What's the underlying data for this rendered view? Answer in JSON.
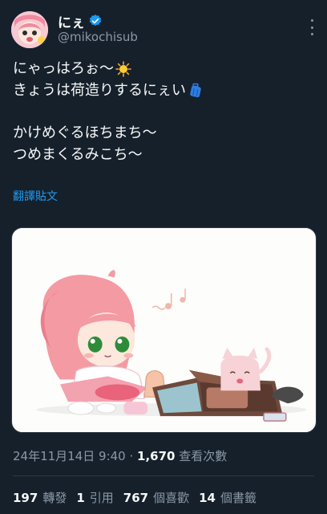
{
  "header": {
    "display_name": "にぇ",
    "handle": "@mikochisub",
    "verified_icon": "verified-badge-icon",
    "more_icon": "more-vertical-icon"
  },
  "tweet": {
    "lines": [
      "にゃっはろぉ〜",
      "きょうは荷造りするにぇい",
      "かけめぐるほちまち〜",
      "つめまくるみこち〜"
    ],
    "emoji": [
      "sun-icon",
      "luggage-icon"
    ],
    "translate_label": "翻譯貼文"
  },
  "meta": {
    "timestamp": "24年11月14日 9:40",
    "separator": " · ",
    "views_count": "1,670",
    "views_label": "查看次數"
  },
  "stats": [
    {
      "count": "197",
      "label": "轉發"
    },
    {
      "count": "1",
      "label": "引用"
    },
    {
      "count": "767",
      "label": "個喜歡"
    },
    {
      "count": "14",
      "label": "個書籤"
    }
  ],
  "colors": {
    "background": "#15202b",
    "text": "#f7f9f9",
    "muted": "#8b98a5",
    "link": "#1d9bf0",
    "divider": "#2f3b47"
  }
}
